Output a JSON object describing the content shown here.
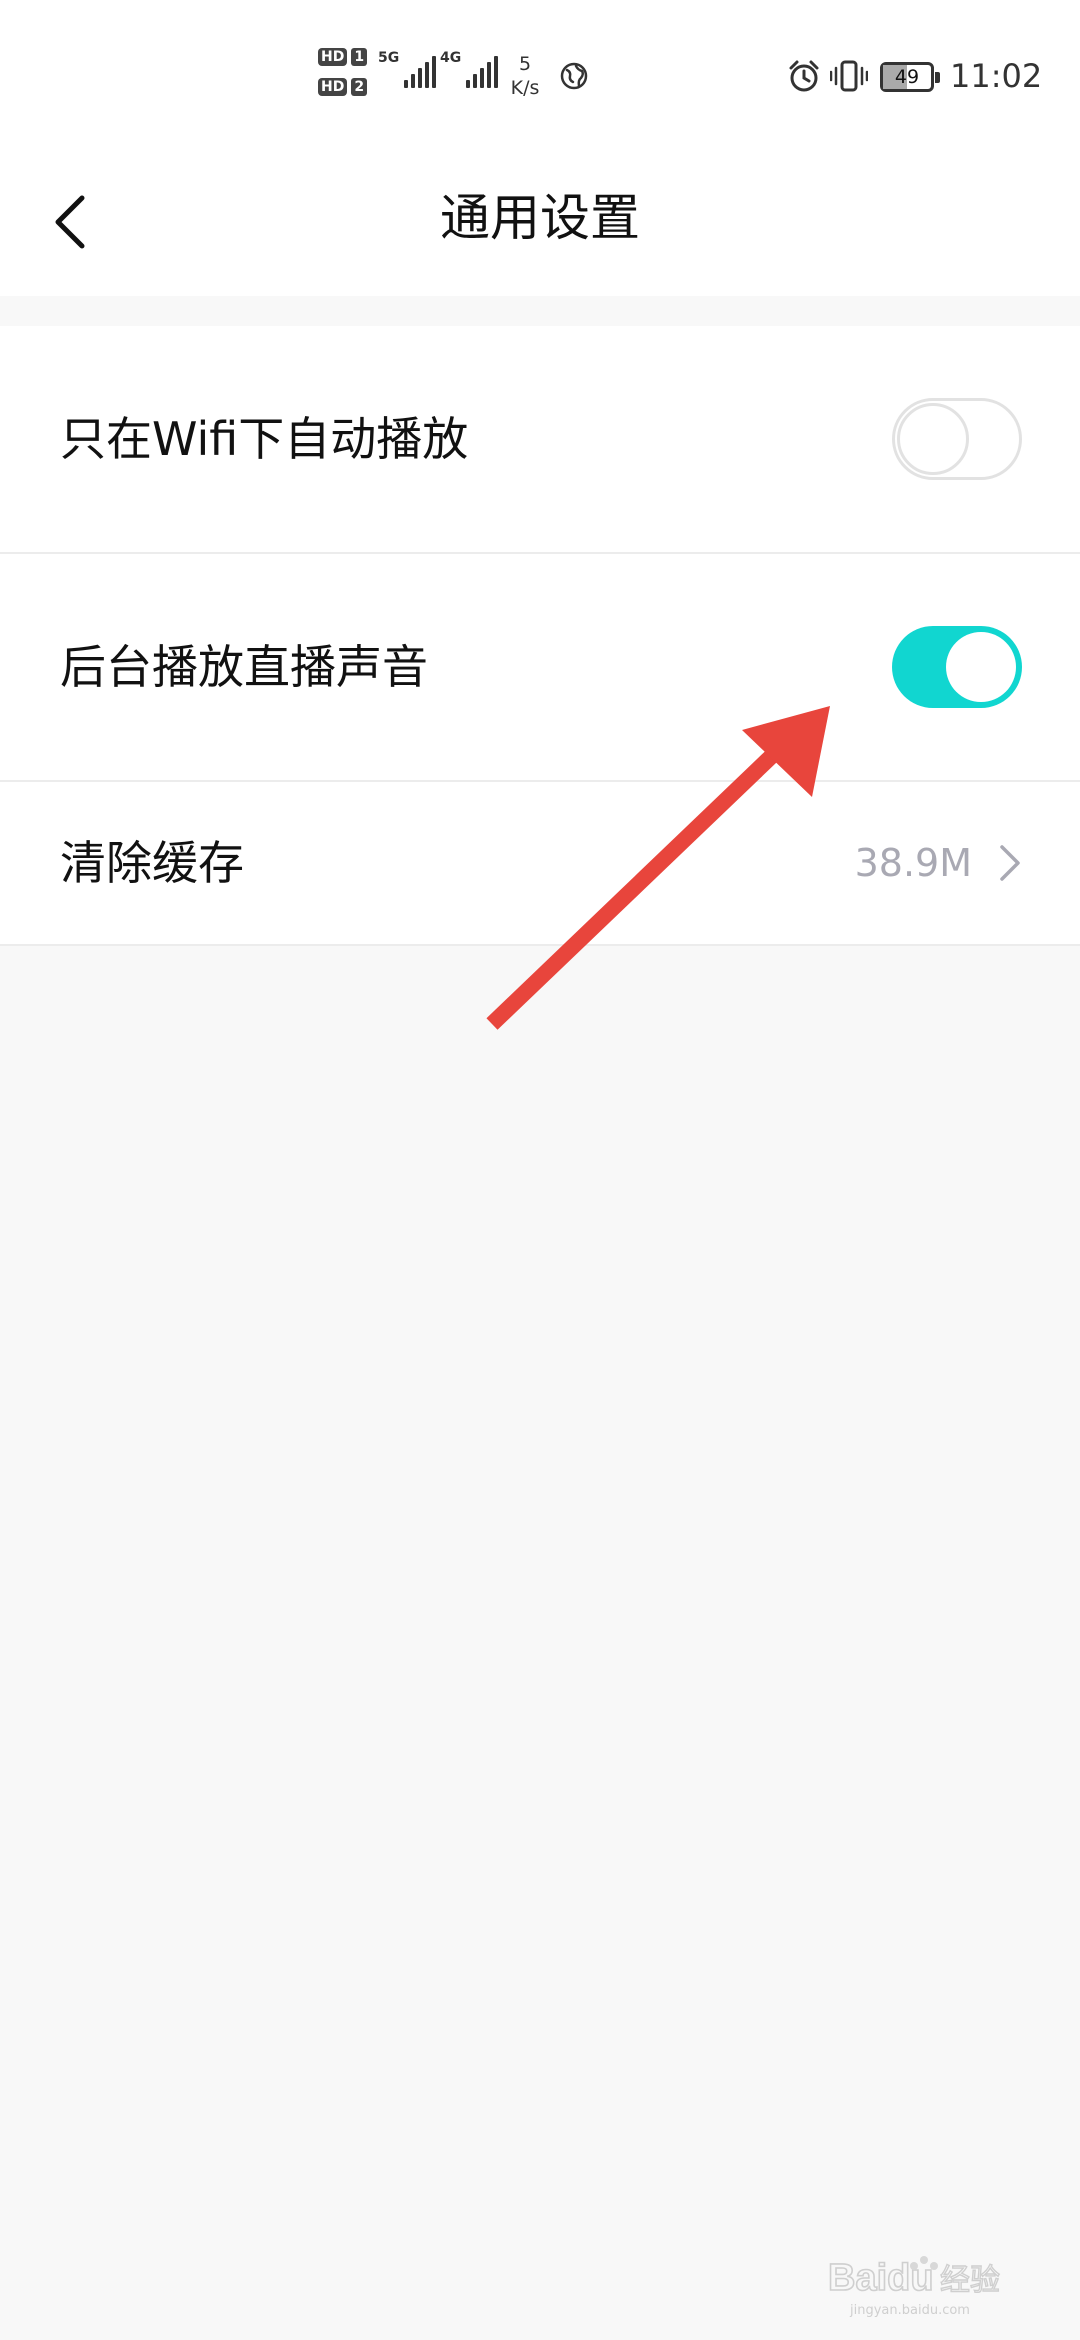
{
  "status_bar": {
    "sim1_badge": "HD",
    "sim1_number": "1",
    "sim2_badge": "HD",
    "sim2_number": "2",
    "network1": "5G",
    "network2": "4G",
    "speed_value": "5",
    "speed_unit": "K/s",
    "battery_level": "49",
    "time": "11:02"
  },
  "header": {
    "title": "通用设置"
  },
  "settings": {
    "wifi_autoplay_label": "只在Wifi下自动播放",
    "background_audio_label": "后台播放直播声音",
    "clear_cache_label": "清除缓存",
    "cache_size": "38.9M"
  },
  "toggles": {
    "wifi_autoplay": false,
    "background_audio": true
  },
  "colors": {
    "accent": "#11d6d0",
    "annotation": "#e8453c",
    "secondary_text": "#a9a9b3",
    "page_background": "#f8f8f8"
  },
  "watermark": {
    "brand": "Baidu",
    "suffix": "经验",
    "site": "jingyan.baidu.com"
  }
}
